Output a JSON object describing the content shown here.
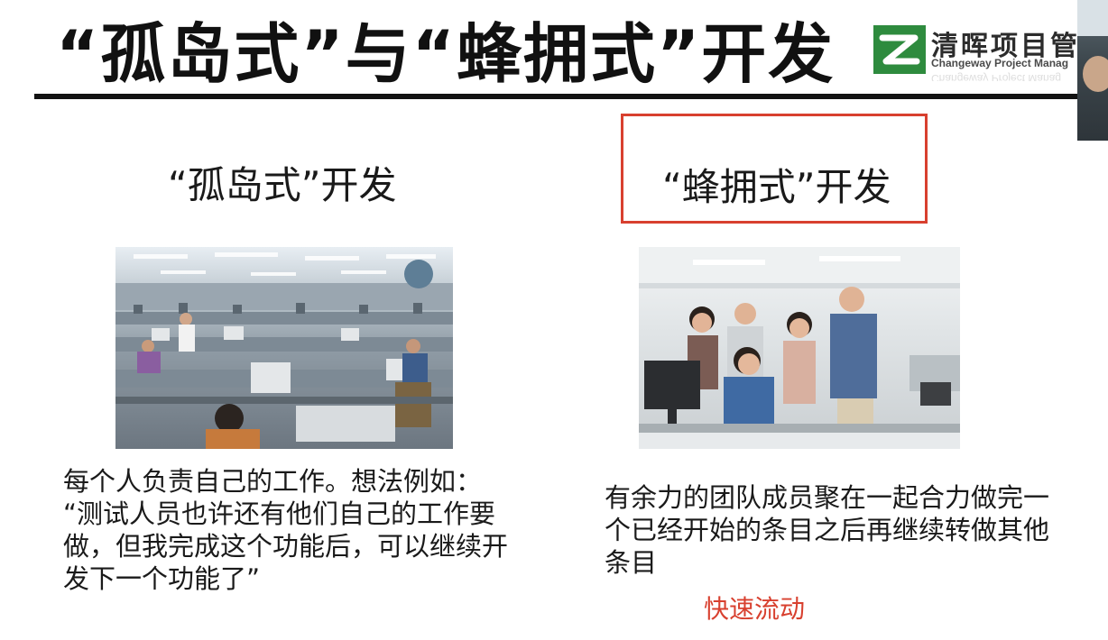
{
  "slide": {
    "title": "“孤岛式”与“蜂拥式”开发"
  },
  "logo": {
    "name_cn": "清晖项目管",
    "name_en": "Changeway Project Manag",
    "mark_color": "#2e8b3e"
  },
  "left": {
    "heading": "“孤岛式”开发",
    "image_label": "office-cubicles-photo",
    "description_lines": [
      "每个人负责自己的工作。想法例如：",
      "“测试人员也许还有他们自己的工作要",
      "做，但我完成这个功能后，可以继续开",
      "发下一个功能了”"
    ]
  },
  "right": {
    "heading": "“蜂拥式”开发",
    "image_label": "team-celebrating-photo",
    "highlight_color": "#d8402f",
    "description_lines": [
      "有余力的团队成员聚在一起合力做完一",
      "个已经开始的条目之后再继续转做其他",
      "条目"
    ],
    "note": "快速流动",
    "note_color": "#d8402f"
  }
}
